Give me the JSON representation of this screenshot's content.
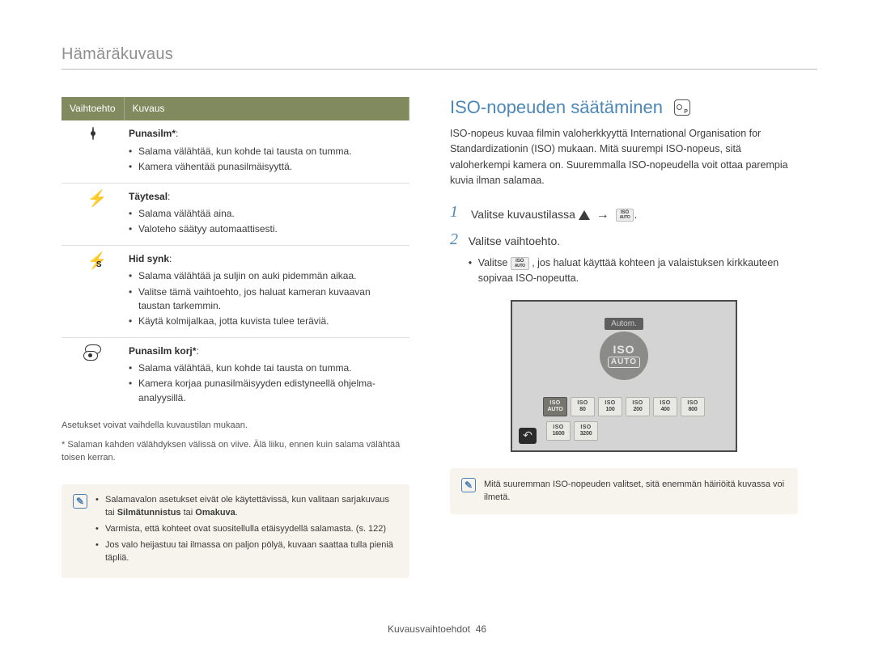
{
  "section_title": "Hämäräkuvaus",
  "table": {
    "headers": {
      "option": "Vaihtoehto",
      "desc": "Kuvaus"
    },
    "rows": [
      {
        "icon": "eye-redeye-icon",
        "name": "Punasilm*",
        "bullets": [
          "Salama välähtää, kun kohde tai tausta on tumma.",
          "Kamera vähentää punasilmäisyyttä."
        ]
      },
      {
        "icon": "flash-fill-icon",
        "name": "Täytesal",
        "bullets": [
          "Salama välähtää aina.",
          "Valoteho säätyy automaattisesti."
        ]
      },
      {
        "icon": "flash-slow-sync-icon",
        "name": "Hid synk",
        "bullets": [
          "Salama välähtää ja suljin on auki pidemmän aikaa.",
          "Valitse tämä vaihtoehto, jos haluat kameran kuvaavan taustan tarkemmin.",
          "Käytä kolmijalkaa, jotta kuvista tulee teräviä."
        ]
      },
      {
        "icon": "eye-redeye-fix-icon",
        "name": "Punasilm korj*",
        "bullets": [
          "Salama välähtää, kun kohde tai tausta on tumma.",
          "Kamera korjaa punasilmäisyyden edistyneellä ohjelma-analyysillä."
        ]
      }
    ],
    "footnote1": "Asetukset voivat vaihdella kuvaustilan mukaan.",
    "footnote2": "* Salaman kahden välähdyksen välissä on viive. Älä liiku, ennen kuin salama välähtää toisen kerran."
  },
  "info_left": {
    "items": [
      "Salamavalon asetukset eivät ole käytettävissä, kun valitaan sarjakuvaus tai Silmätunnistus tai Omakuva.",
      "Varmista, että kohteet ovat suositellulla etäisyydellä salamasta. (s. 122)",
      "Jos valo heijastuu tai ilmassa on paljon pölyä, kuvaan saattaa tulla pieniä täpliä."
    ],
    "strong_words": [
      "Silmätunnistus",
      "Omakuva"
    ]
  },
  "right": {
    "heading": "ISO-nopeuden säätäminen",
    "mode_icon": "camera-mode-p-icon",
    "paragraph": "ISO-nopeus kuvaa filmin valoherkkyyttä International Organisation for Standardizationin (ISO) mukaan. Mitä suurempi ISO-nopeus, sitä valoherkempi kamera on. Suuremmalla ISO-nopeudella voit ottaa parempia kuvia ilman salamaa.",
    "steps": {
      "1": {
        "text_before": "Valitse kuvaustilassa ",
        "text_after": "."
      },
      "2": {
        "main": "Valitse vaihtoehto.",
        "sub_before": "Valitse ",
        "sub_after": ", jos haluat käyttää kohteen ja valaistuksen kirkkauteen sopivaa ISO-nopeutta."
      }
    },
    "iso_label": "Autom.",
    "iso_big": {
      "top": "ISO",
      "bottom": "AUTO"
    },
    "iso_values_row1": [
      "AUTO",
      "80",
      "100",
      "200",
      "400",
      "800"
    ],
    "iso_values_row2": [
      "1600",
      "3200"
    ],
    "info_right": "Mitä suuremman ISO-nopeuden valitset, sitä enemmän häiriöitä kuvassa voi ilmetä."
  },
  "footer": {
    "label": "Kuvausvaihtoehdot",
    "page": "46"
  }
}
